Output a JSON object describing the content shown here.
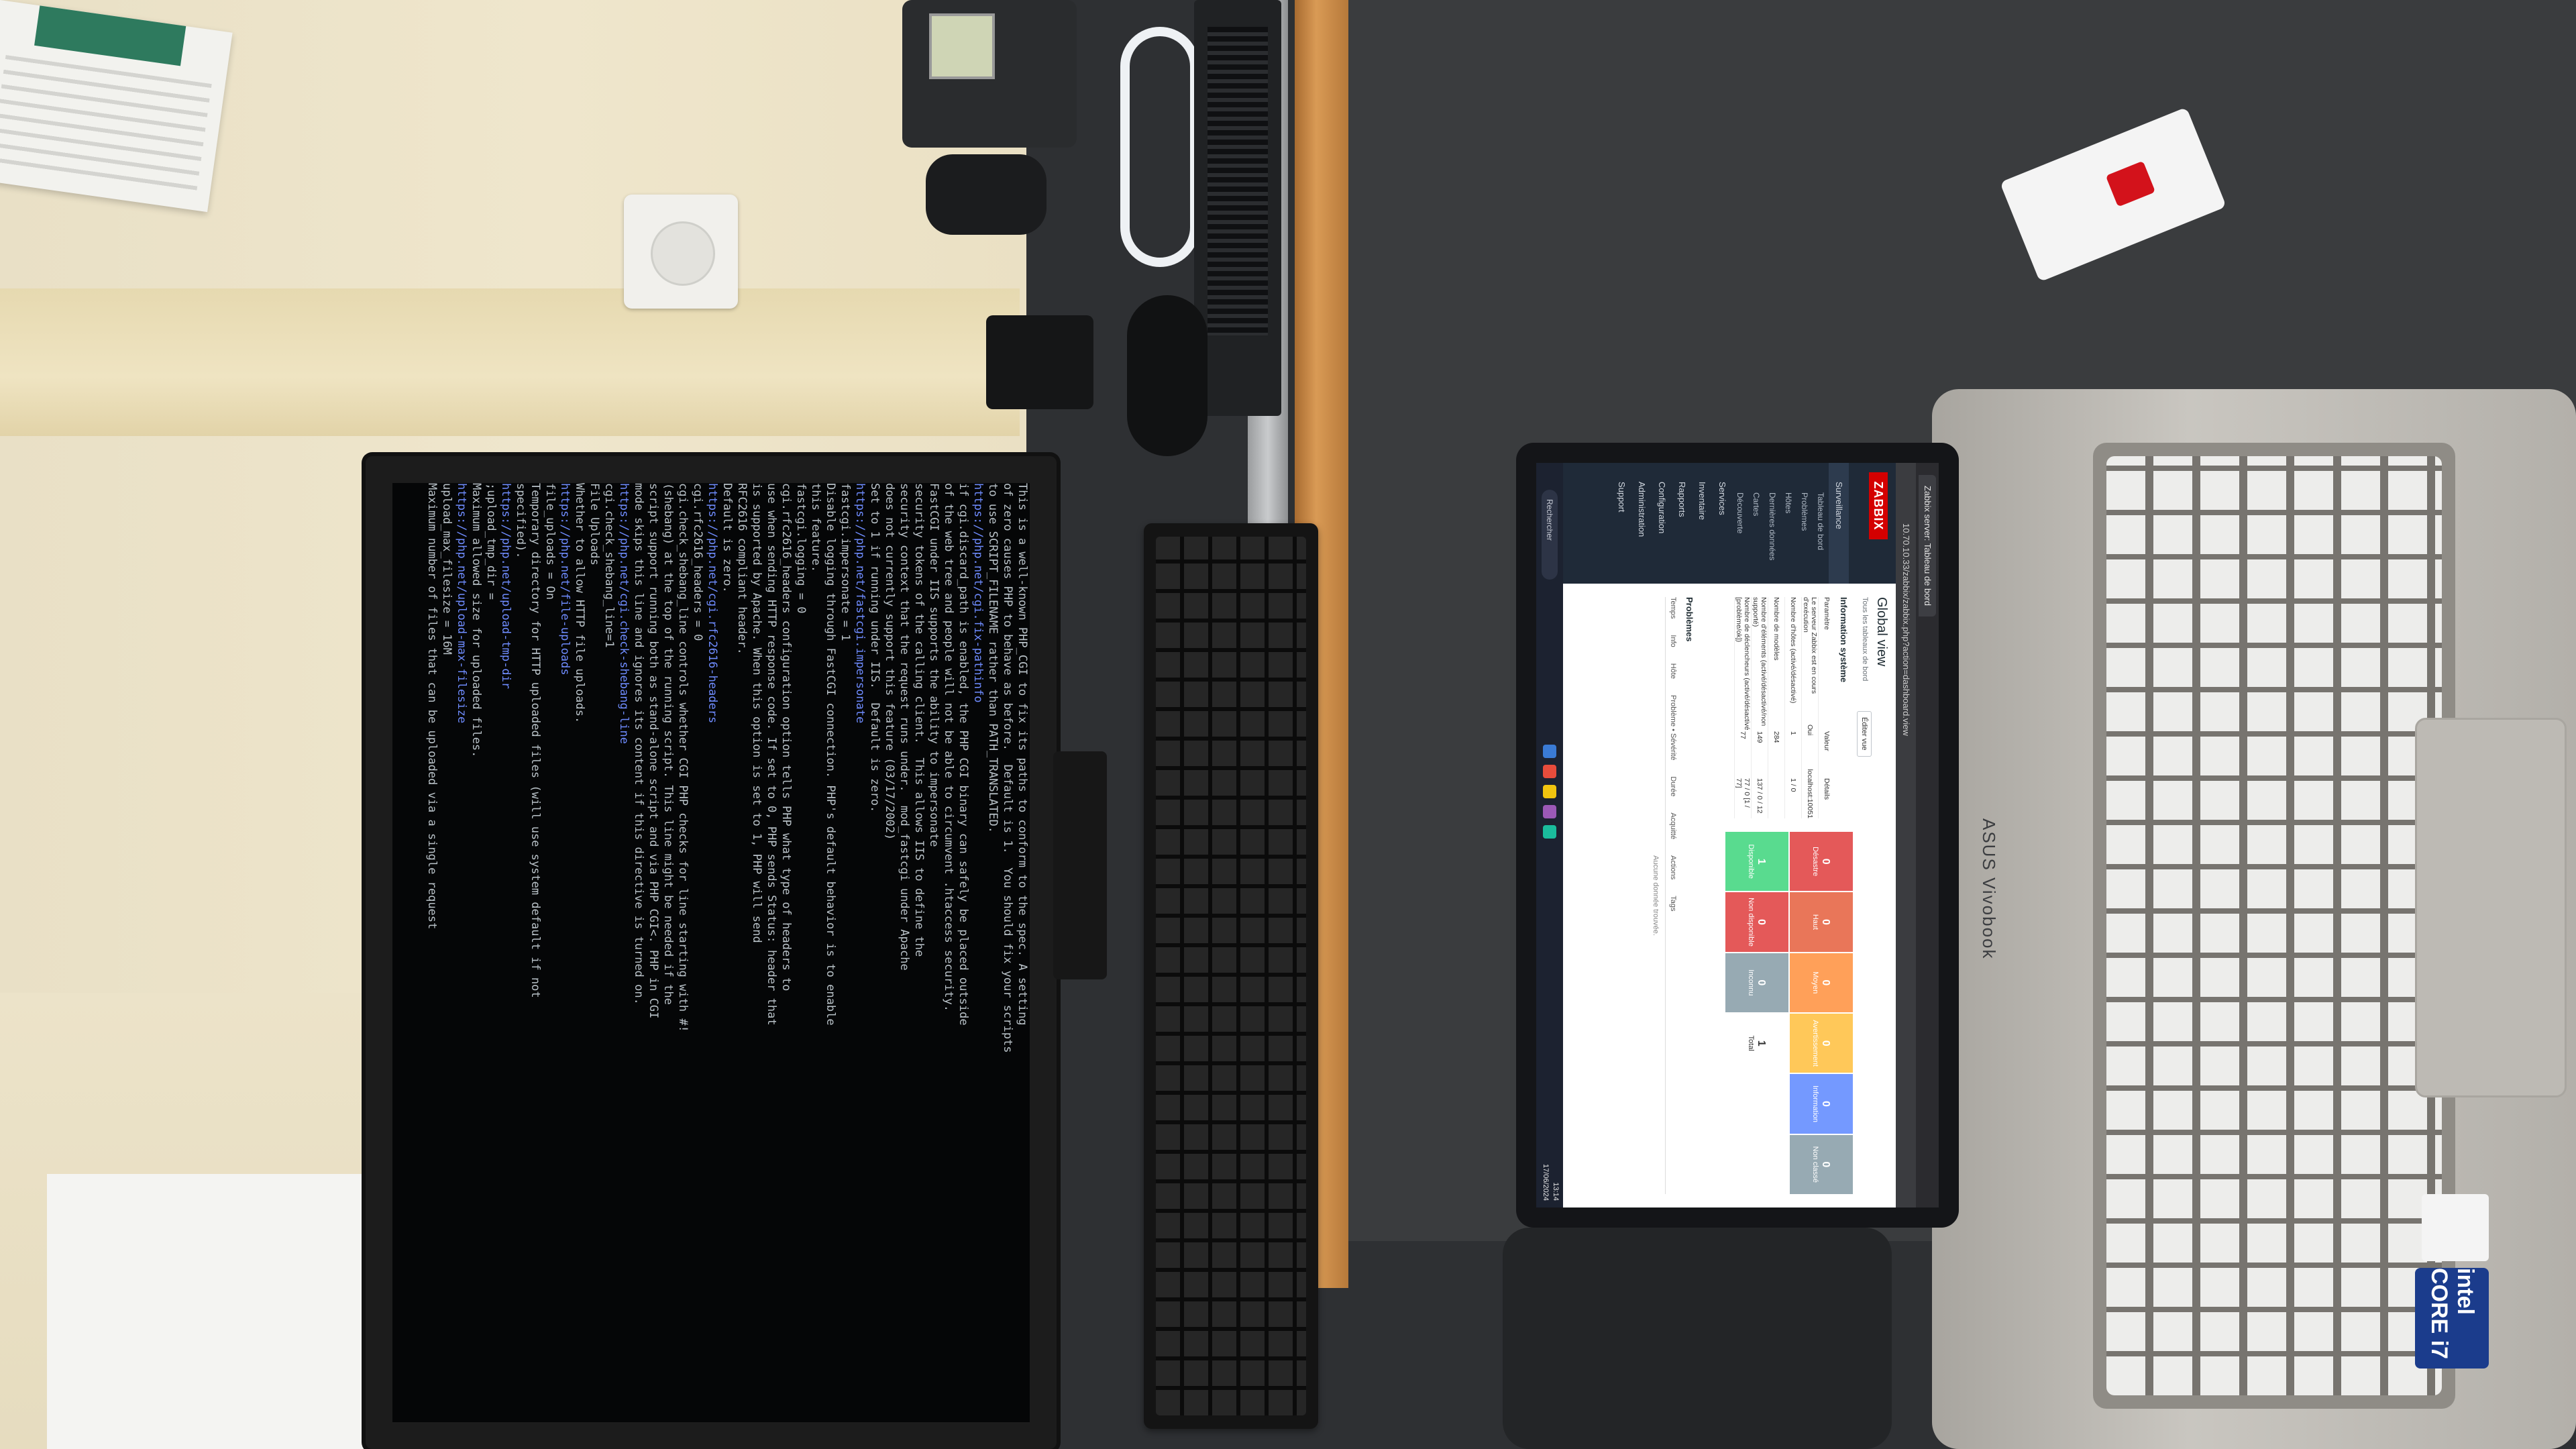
{
  "terminal": {
    "lines": [
      "This is a well-known PHP_CGI to fix its paths to conform to the spec. A setting",
      "of zero causes PHP to behave as before.  Default is 1.  You should fix your scripts",
      "to use SCRIPT_FILENAME rather than PATH_TRANSLATED.",
      "https://php.net/cgi.fix-pathinfo",
      "",
      "if cgi.discard_path is enabled, the PHP CGI binary can safely be placed outside",
      "of the web tree and people will not be able to circumvent .htaccess security.",
      "",
      "FastCGI under IIS supports the ability to impersonate",
      "security tokens of the calling client.  This allows IIS to define the",
      "security context that the request runs under.  mod_fastcgi under Apache",
      "does not currently support this feature (03/17/2002)",
      "Set to 1 if running under IIS.  Default is zero.",
      "https://php.net/fastcgi.impersonate",
      "fastcgi.impersonate = 1",
      "",
      "Disable logging through FastCGI connection. PHP's default behavior is to enable",
      "this feature.",
      "fastcgi.logging = 0",
      "",
      "cgi.rfc2616_headers configuration option tells PHP what type of headers to",
      "use when sending HTTP response code. If set to 0, PHP sends Status: header that",
      "is supported by Apache. When this option is set to 1, PHP will send",
      "RFC2616 compliant header.",
      "Default is zero.",
      "https://php.net/cgi.rfc2616-headers",
      "cgi.rfc2616_headers = 0",
      "",
      "cgi.check_shebang_line controls whether CGI PHP checks for line starting with #!",
      "(shebang) at the top of the running script. This line might be needed if the",
      "script support running both as stand-alone script and via PHP CGI<. PHP in CGI",
      "mode skips this line and ignores its content if this directive is turned on.",
      "https://php.net/cgi.check-shebang-line",
      "cgi.check_shebang_line=1",
      "",
      "File Uploads",
      "",
      "Whether to allow HTTP file uploads.",
      "https://php.net/file-uploads",
      "file_uploads = On",
      "",
      "Temporary directory for HTTP uploaded files (will use system default if not",
      "specified).",
      "https://php.net/upload-tmp-dir",
      ";upload_tmp_dir =",
      "",
      "Maximum allowed size for uploaded files.",
      "https://php.net/upload-max-filesize",
      "upload_max_filesize = 16M",
      "",
      "Maximum number of files that can be uploaded via a single request"
    ],
    "highlight_indices": [
      3,
      13,
      25,
      32,
      38,
      43,
      47
    ]
  },
  "laptop": {
    "brand": "ASUS Vivobook",
    "sticker": "intel CORE i7",
    "browser_tab": "Zabbix server: Tableau de bord",
    "url": "10.70.10.33/zabbix/zabbix.php?action=dashboard.view",
    "zabbix": {
      "logo": "ZABBIX",
      "menu": [
        {
          "label": "Surveillance",
          "active": true
        },
        {
          "label": "Tableau de bord",
          "sub": true
        },
        {
          "label": "Problèmes",
          "sub": true
        },
        {
          "label": "Hôtes",
          "sub": true
        },
        {
          "label": "Dernières données",
          "sub": true
        },
        {
          "label": "Cartes",
          "sub": true
        },
        {
          "label": "Découverte",
          "sub": true
        },
        {
          "label": "Services",
          "active": false
        },
        {
          "label": "Inventaire",
          "active": false
        },
        {
          "label": "Rapports",
          "active": false
        },
        {
          "label": "Configuration",
          "active": false
        },
        {
          "label": "Administration",
          "active": false
        },
        {
          "label": "Support",
          "active": false
        }
      ],
      "title": "Global view",
      "crumb": "Tous les tableaux de bord",
      "edit_button": "Éditer vue",
      "sysinfo_heading": "Information système",
      "sysinfo_headers": [
        "Paramètre",
        "Valeur",
        "Détails"
      ],
      "sysinfo_rows": [
        [
          "Le serveur Zabbix est en cours d'exécution",
          "Oui",
          "localhost:10051"
        ],
        [
          "Nombre d'hôtes (activé/désactivé)",
          "1",
          "1 / 0"
        ],
        [
          "Nombre de modèles",
          "284",
          ""
        ],
        [
          "Nombre d'éléments (activé/désactivé/non supporté)",
          "149",
          "137 / 0 / 12"
        ],
        [
          "Nombre de déclencheurs (activé/désactivé [problème/ok])",
          "77",
          "77 / 0 [1 / 77]"
        ]
      ],
      "severity": [
        {
          "label": "Désastre",
          "count": "0",
          "color": "#e45959"
        },
        {
          "label": "Haut",
          "count": "0",
          "color": "#e97659"
        },
        {
          "label": "Moyen",
          "count": "0",
          "color": "#ffa059"
        },
        {
          "label": "Avertissement",
          "count": "0",
          "color": "#ffc859"
        },
        {
          "label": "Information",
          "count": "0",
          "color": "#7499ff"
        },
        {
          "label": "Non classé",
          "count": "0",
          "color": "#97aab3"
        },
        {
          "label": "Disponible",
          "count": "1",
          "color": "#59db8f"
        },
        {
          "label": "Non disponible",
          "count": "0",
          "color": "#e45959"
        },
        {
          "label": "Inconnu",
          "count": "0",
          "color": "#97aab3"
        },
        {
          "label": "Total",
          "count": "1",
          "color": "#ffffff"
        }
      ],
      "problems_heading": "Problèmes",
      "problems_headers": [
        "Temps",
        "Info",
        "Hôte",
        "Problème • Sévérité",
        "Durée",
        "Acquitté",
        "Actions",
        "Tags"
      ],
      "problems_empty": "Aucune donnée trouvée.",
      "taskbar_search": "Rechercher",
      "clock_time": "13:14",
      "clock_date": "17/06/2024"
    }
  },
  "colors": {
    "zabbix_red": "#d40000",
    "power_switch": "#d3121b",
    "desk_edge": "#c88a48"
  }
}
